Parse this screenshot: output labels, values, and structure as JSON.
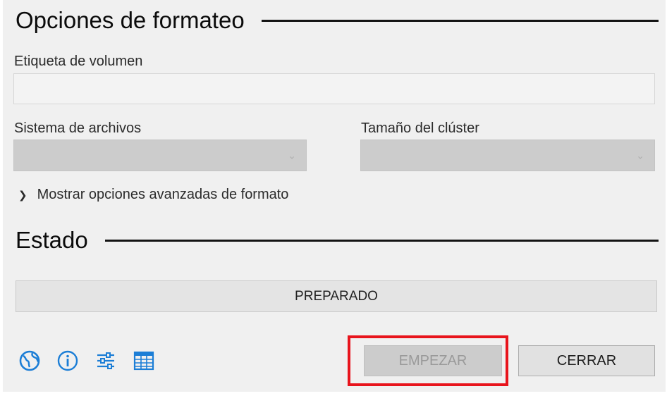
{
  "format_options": {
    "title": "Opciones de formateo",
    "volume_label": "Etiqueta de volumen",
    "volume_value": "",
    "filesystem_label": "Sistema de archivos",
    "filesystem_value": "",
    "cluster_label": "Tamaño del clúster",
    "cluster_value": "",
    "advanced_toggle": "Mostrar opciones avanzadas de formato"
  },
  "status": {
    "title": "Estado",
    "text": "PREPARADO"
  },
  "toolbar": {
    "icons": [
      "globe-icon",
      "info-icon",
      "settings-sliders-icon",
      "log-table-icon"
    ],
    "accent_color": "#1c7ed6"
  },
  "buttons": {
    "start_label": "EMPEZAR",
    "close_label": "CERRAR"
  },
  "highlight_color": "#e8141c"
}
